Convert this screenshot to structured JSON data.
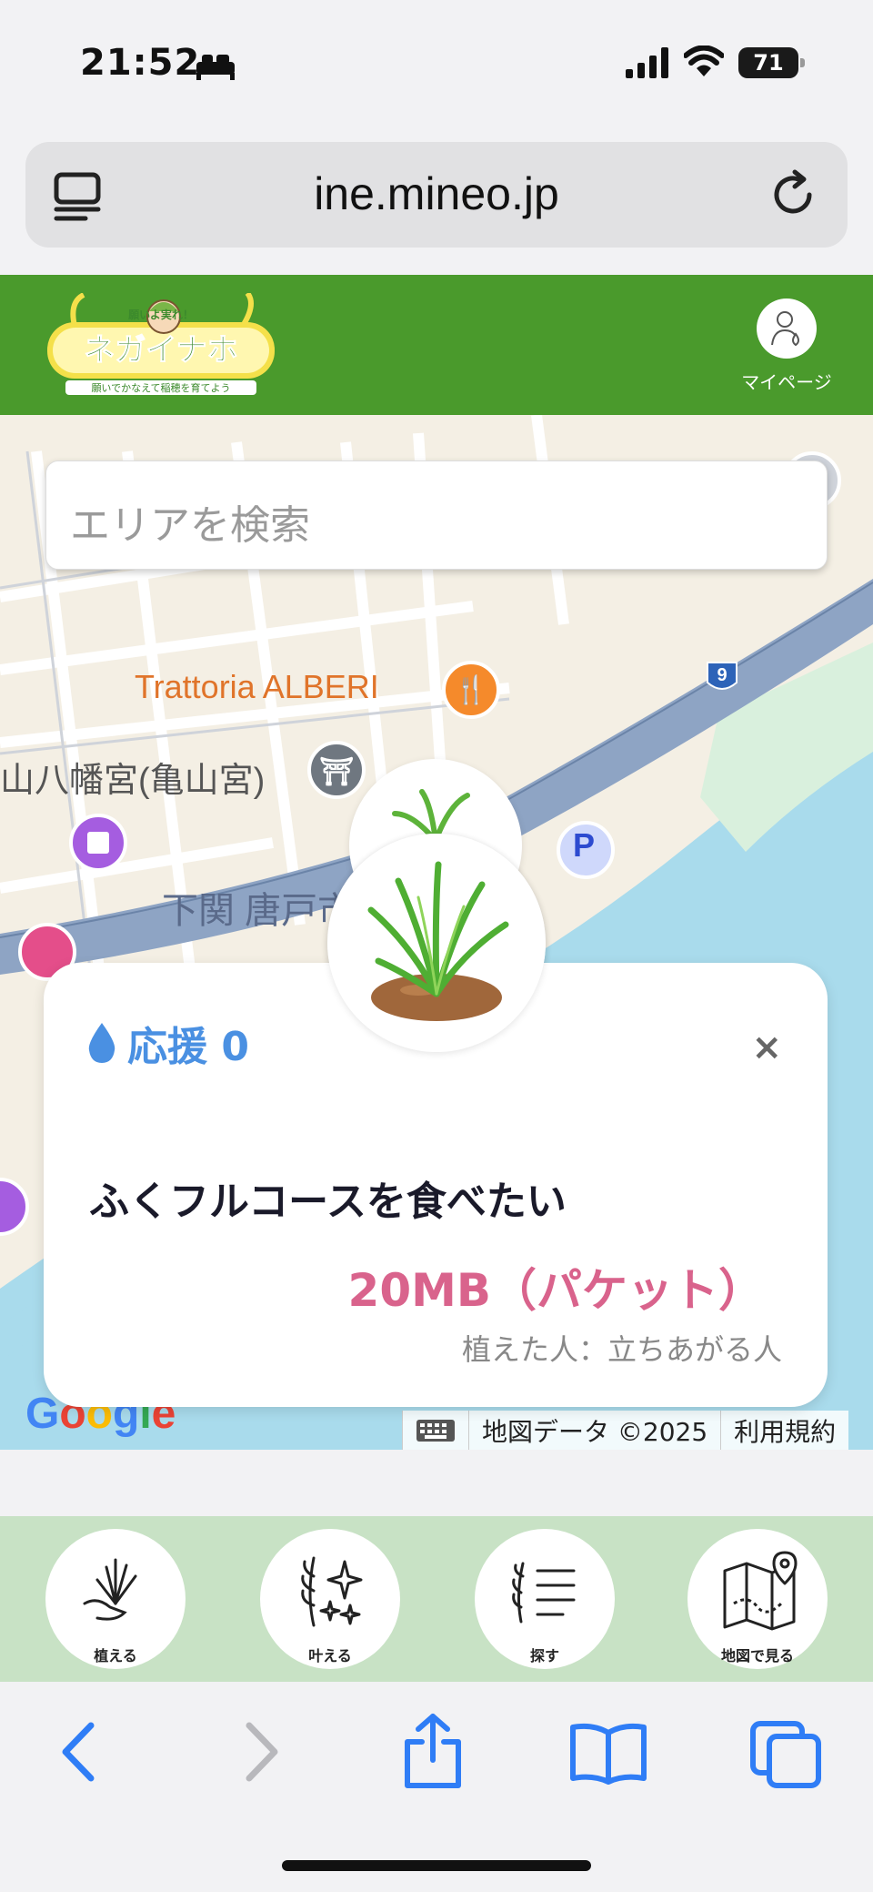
{
  "status_bar": {
    "time": "21:52",
    "battery": "71"
  },
  "browser": {
    "url": "ine.mineo.jp"
  },
  "site": {
    "logo_text": "ネガイナホ",
    "logo_tagline": "願いよ実れ！",
    "logo_sub": "願いでかなえて稲穂を育てよう",
    "mypage_label": "マイページ"
  },
  "map": {
    "search_placeholder": "エリアを検索",
    "poi_restaurant": "Trattoria ALBERI",
    "poi_shrine": "山八幡宮(亀山宮)",
    "poi_area": "下関 唐戸市",
    "route_number": "9",
    "parking": "P",
    "footer": {
      "data": "地図データ ©2025",
      "terms": "利用規約"
    },
    "google": [
      "G",
      "o",
      "o",
      "g",
      "l",
      "e"
    ]
  },
  "card": {
    "support_label": "応援 0",
    "close": "×",
    "wish": "ふくフルコースを食べたい",
    "reward": "20MB（パケット）",
    "planter": "植えた人：立ちあがる人"
  },
  "bottom_nav": [
    {
      "label": "植える",
      "icon": "plant-hand-icon"
    },
    {
      "label": "叶える",
      "icon": "sparkle-rice-icon"
    },
    {
      "label": "探す",
      "icon": "list-rice-icon"
    },
    {
      "label": "地図で見る",
      "icon": "map-pin-icon"
    }
  ],
  "colors": {
    "header_green": "#4a9a2c",
    "nav_green": "#c8e2c5",
    "support_blue": "#4a90e2",
    "reward_pink": "#d9638c",
    "safari_blue": "#2f7df6"
  }
}
